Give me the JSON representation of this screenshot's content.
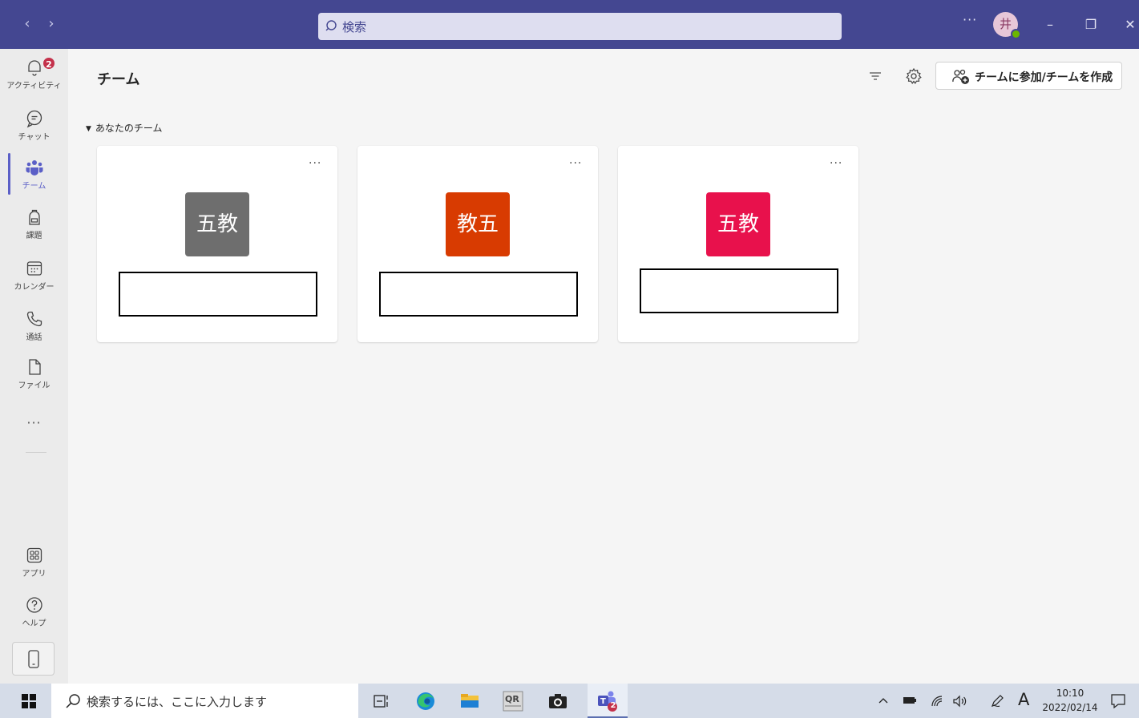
{
  "titlebar": {
    "back": "‹",
    "forward": "›",
    "search_placeholder": "検索",
    "more": "···",
    "avatar_initial": "井",
    "minimize": "–",
    "maximize": "❐",
    "close": "✕"
  },
  "rail": {
    "activity": {
      "label": "アクティビティ",
      "badge": "2"
    },
    "chat": {
      "label": "チャット"
    },
    "teams": {
      "label": "チーム"
    },
    "assignments": {
      "label": "課題"
    },
    "calendar": {
      "label": "カレンダー"
    },
    "calls": {
      "label": "通話"
    },
    "files": {
      "label": "ファイル"
    },
    "more": "···",
    "apps": {
      "label": "アプリ"
    },
    "help": {
      "label": "ヘルプ"
    }
  },
  "main": {
    "title": "チーム",
    "join_button": "チームに参加/チームを作成",
    "section": "あなたのチーム",
    "cards": [
      {
        "tile_text": "五教",
        "tile_color": "#6e6e6e",
        "more": "···"
      },
      {
        "tile_text": "教五",
        "tile_color": "#d83b01",
        "more": "···"
      },
      {
        "tile_text": "五教",
        "tile_color": "#e8114c",
        "more": "···"
      }
    ]
  },
  "taskbar": {
    "search_placeholder": "検索するには、ここに入力します",
    "ime": "A",
    "time": "10:10",
    "date": "2022/02/14",
    "teams_badge": "2"
  },
  "colors": {
    "titlebar": "#444791",
    "accent": "#5b5fc7",
    "badge": "#c4314b"
  }
}
